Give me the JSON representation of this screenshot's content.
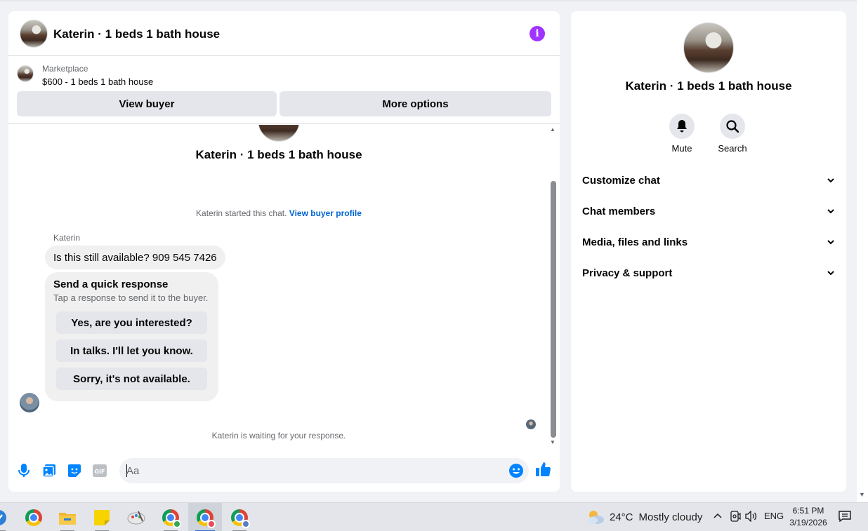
{
  "listing": {
    "title": "Katerin · 1 beds 1 bath house",
    "category_label": "Marketplace",
    "price_line": "$600 - 1 beds 1 bath house"
  },
  "buttons": {
    "view_buyer": "View buyer",
    "more_options": "More options"
  },
  "chat": {
    "started_text": "Katerin started this chat.",
    "view_buyer_profile": "View buyer profile",
    "sender_name": "Katerin",
    "message": "Is this still available? 909 545 7426",
    "quick_response": {
      "title": "Send a quick response",
      "subtitle": "Tap a response to send it to the buyer.",
      "options": [
        "Yes, are you interested?",
        "In talks. I'll let you know.",
        "Sorry, it's not available."
      ]
    },
    "waiting_text": "Katerin is waiting for your response."
  },
  "composer": {
    "placeholder": "Aa"
  },
  "info_panel": {
    "actions": {
      "mute": "Mute",
      "search": "Search"
    },
    "sections": [
      "Customize chat",
      "Chat members",
      "Media, files and links",
      "Privacy & support"
    ]
  },
  "taskbar": {
    "weather_temp": "24°C",
    "weather_text": "Mostly cloudy",
    "language": "ENG",
    "time": "6:51 PM",
    "date": "3/19/2026"
  },
  "colors": {
    "accent_blue": "#0084ff",
    "link_blue": "#0064d1",
    "info_purple": "#a033ff"
  }
}
